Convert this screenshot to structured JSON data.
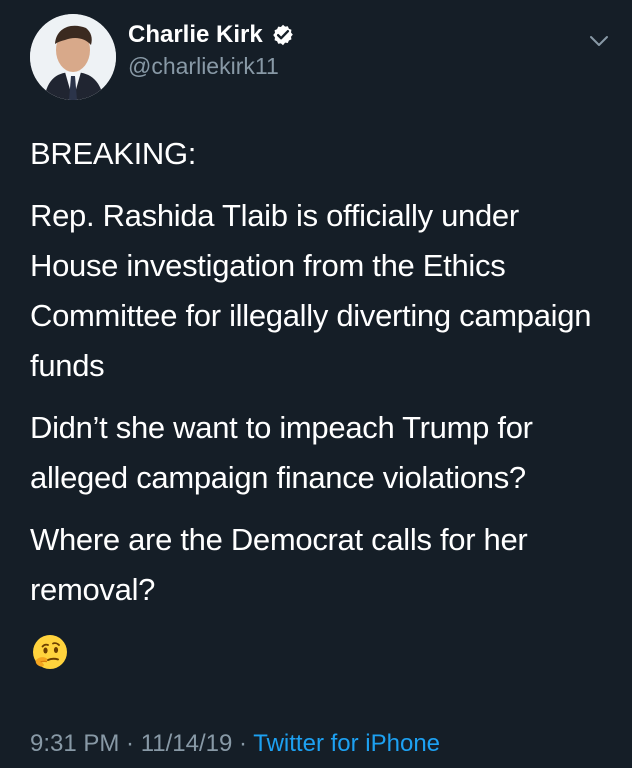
{
  "tweet": {
    "author": {
      "display_name": "Charlie Kirk",
      "handle": "@charliekirk11",
      "verified": true
    },
    "paragraphs": [
      "BREAKING:",
      "Rep. Rashida Tlaib is officially under House investigation from the Ethics Committee for illegally diverting campaign funds",
      "Didn’t she want to impeach Trump for alleged campaign finance violations?",
      "Where are the Democrat calls for her removal?"
    ],
    "emoji": "thinking-face",
    "timestamp": "9:31 PM · 11/14/19",
    "separator": "·",
    "source": "Twitter for iPhone"
  },
  "icons": {
    "verified": "verified-badge-icon",
    "menu": "chevron-down-icon"
  },
  "colors": {
    "background": "#151e27",
    "text": "#ffffff",
    "muted": "#8899a6",
    "link": "#1da1f2"
  }
}
